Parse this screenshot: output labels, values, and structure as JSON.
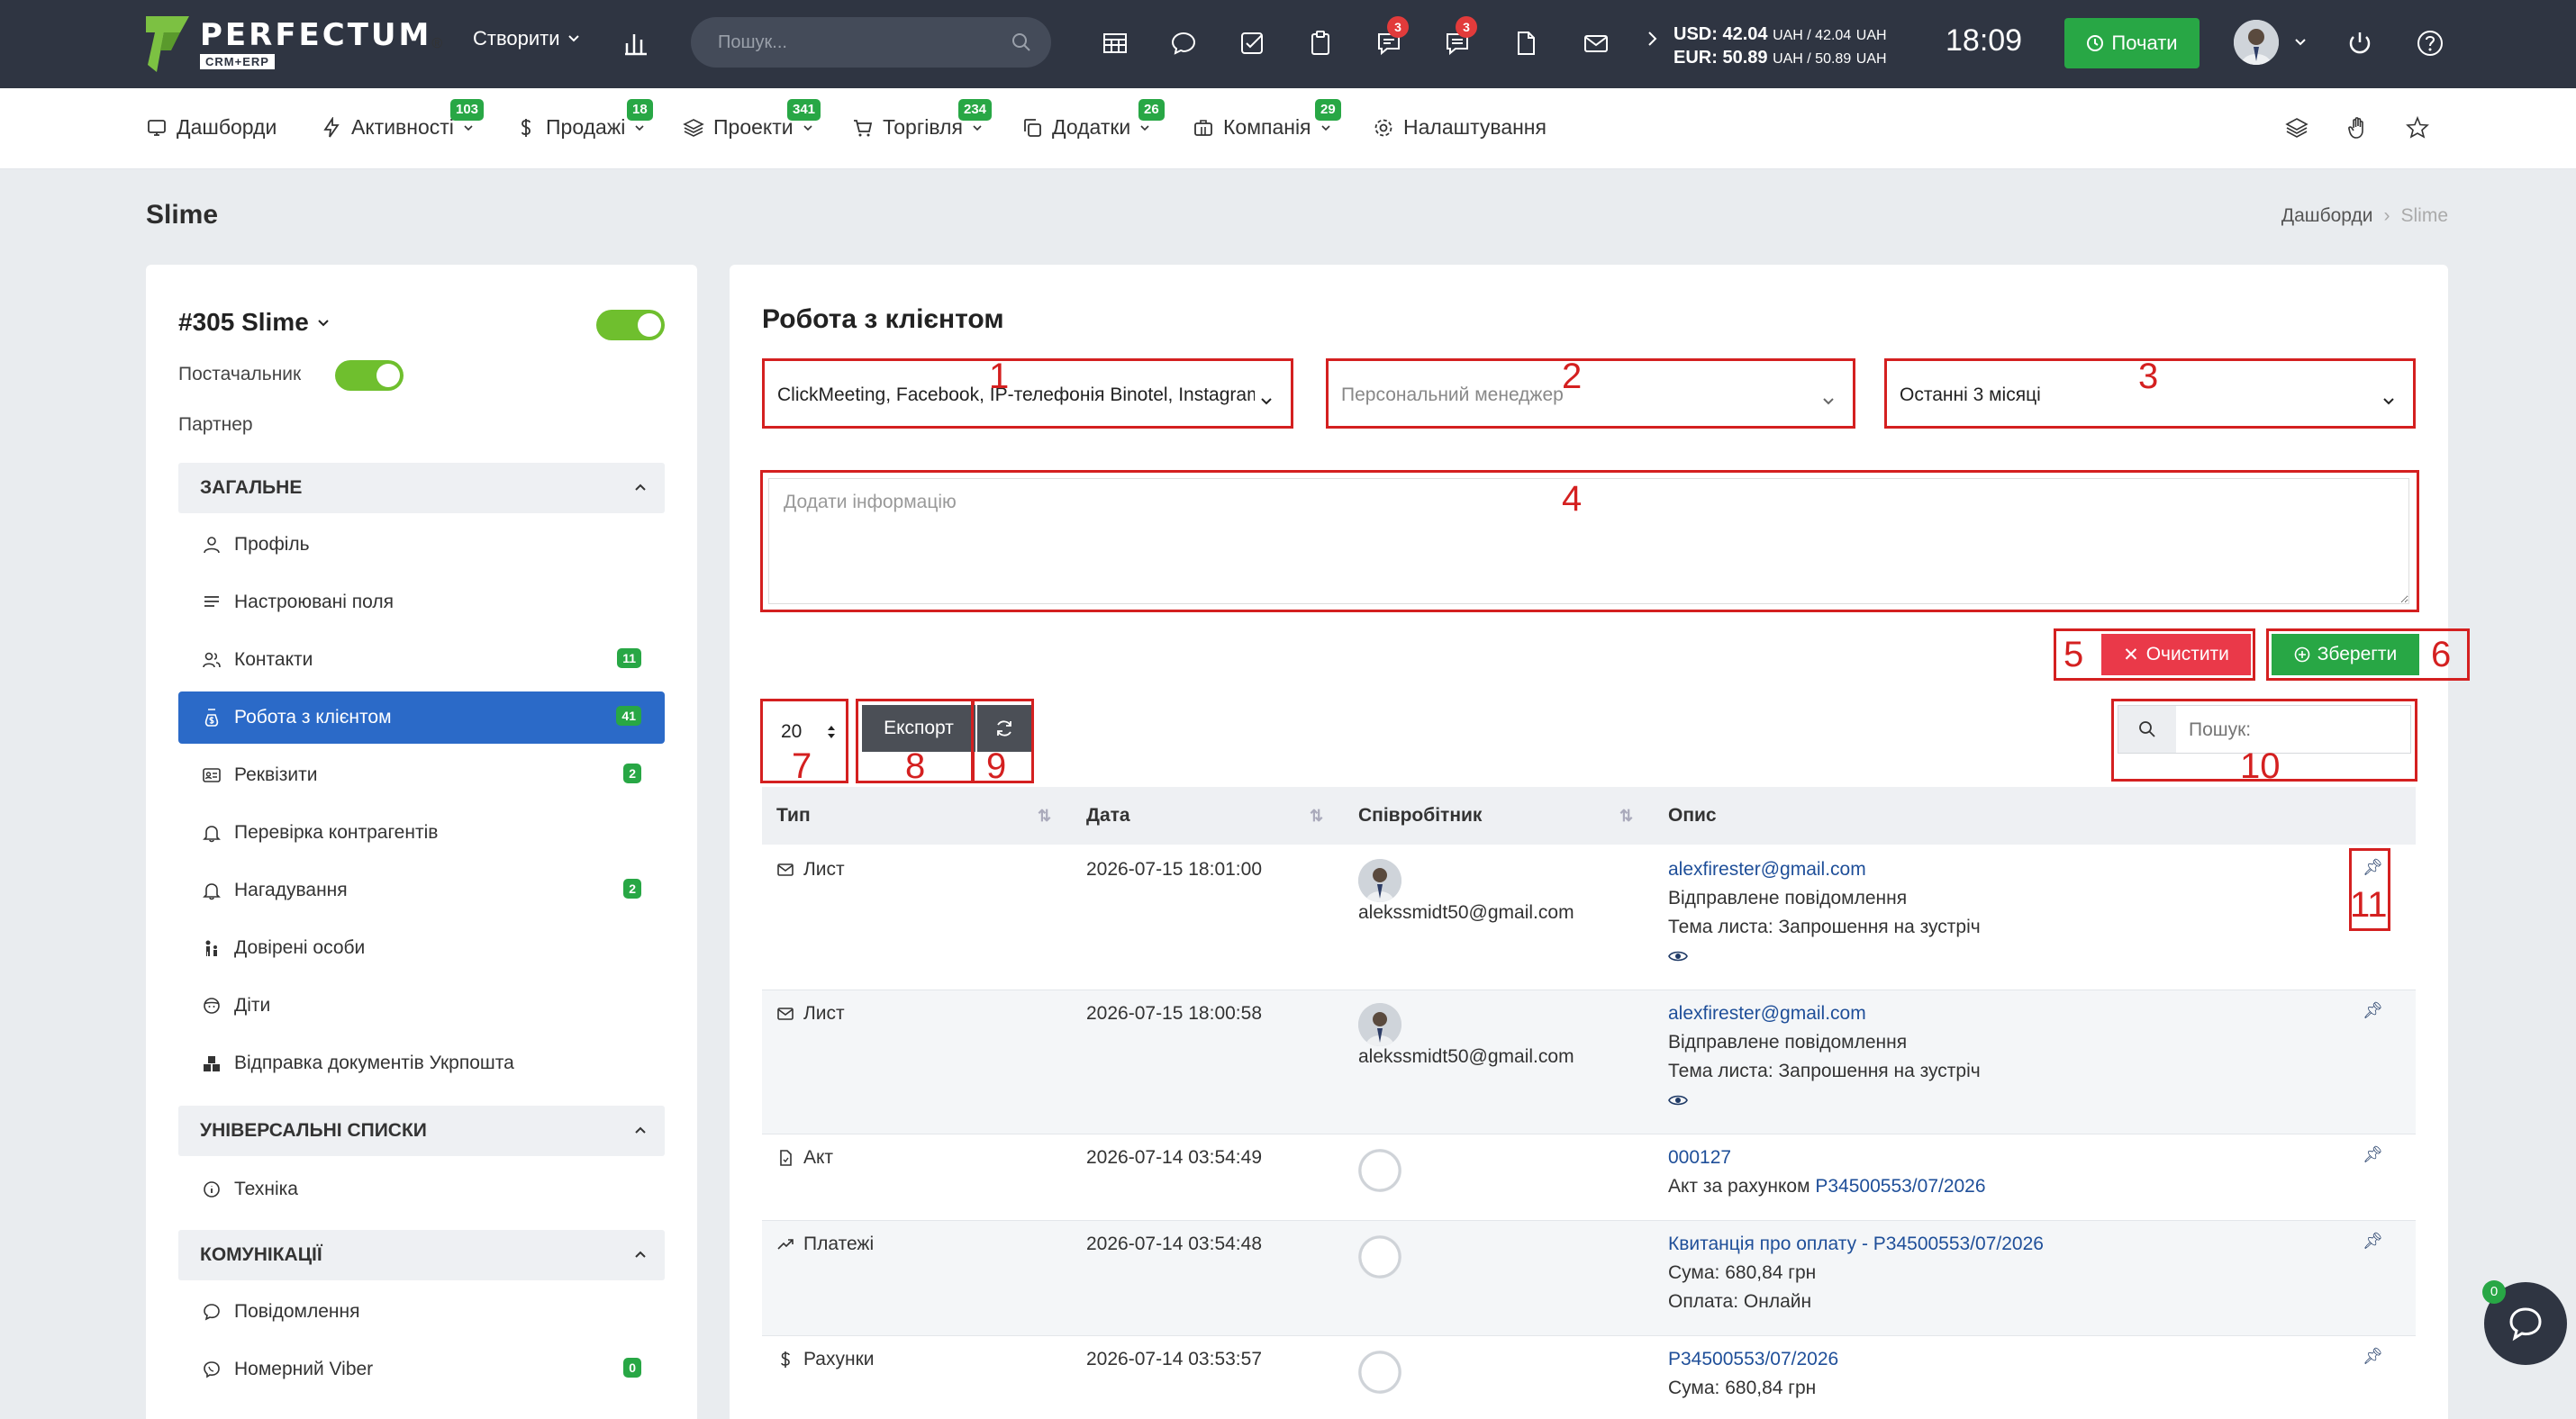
{
  "topbar": {
    "logo_text": "PERFECTUM",
    "logo_sub": "CRM+ERP",
    "logo_reg": "®",
    "create_label": "Створити",
    "search_placeholder": "Пошук...",
    "badge_messages": "3",
    "badge_chats": "3",
    "rate_usd": "USD: 42.04",
    "rate_usd_unit": "UAH / 42.04",
    "rate_usd_unit2": "UAH",
    "rate_eur": "EUR: 50.89",
    "rate_eur_unit": "UAH / 50.89",
    "rate_eur_unit2": "UAH",
    "clock": "18:09",
    "start_label": "Почати"
  },
  "menu": [
    {
      "label": "Дашборди",
      "icon": "monitor-icon"
    },
    {
      "label": "Активності",
      "icon": "bolt-icon",
      "badge": "103"
    },
    {
      "label": "Продажі",
      "icon": "dollar-icon",
      "badge": "18"
    },
    {
      "label": "Проекти",
      "icon": "layers-icon",
      "badge": "341"
    },
    {
      "label": "Торгівля",
      "icon": "cart-icon",
      "badge": "234"
    },
    {
      "label": "Додатки",
      "icon": "copy-icon",
      "badge": "26"
    },
    {
      "label": "Компанія",
      "icon": "briefcase-icon",
      "badge": "29"
    },
    {
      "label": "Налаштування",
      "icon": "gear-icon"
    }
  ],
  "page": {
    "title": "Slime",
    "breadcrumb_home": "Дашборди",
    "breadcrumb_current": "Slime"
  },
  "client": {
    "name": "#305 Slime",
    "supplier_label": "Постачальник",
    "partner_label": "Партнер"
  },
  "sections": {
    "general": "ЗАГАЛЬНЕ",
    "lists": "УНІВЕРСАЛЬНІ СПИСКИ",
    "comms": "КОМУНІКАЦІЇ"
  },
  "nav": [
    {
      "label": "Профіль",
      "icon": "user-icon"
    },
    {
      "label": "Настроювані поля",
      "icon": "lines-icon"
    },
    {
      "label": "Контакти",
      "icon": "users-icon",
      "count": "11"
    },
    {
      "label": "Робота з клієнтом",
      "icon": "dollar-circle-icon",
      "count": "41"
    },
    {
      "label": "Реквізити",
      "icon": "id-card-icon",
      "count": "2"
    },
    {
      "label": "Перевірка контрагентів",
      "icon": "bell-icon"
    },
    {
      "label": "Нагадування",
      "icon": "bell-icon",
      "count": "2"
    },
    {
      "label": "Довірені особи",
      "icon": "people-icon"
    },
    {
      "label": "Діти",
      "icon": "baby-icon"
    },
    {
      "label": "Відправка документів Укрпошта",
      "icon": "boxes-icon"
    },
    {
      "label": "Техніка",
      "icon": "info-icon"
    },
    {
      "label": "Повідомлення",
      "icon": "chat-icon"
    },
    {
      "label": "Номерний Viber",
      "icon": "viber-icon",
      "count": "0"
    }
  ],
  "work": {
    "title": "Робота з клієнтом",
    "sources_value": "ClickMeeting, Facebook, IP-телефонія Binotel, Instagram",
    "manager_placeholder": "Персональний менеджер",
    "period_value": "Останні 3 місяці",
    "note_placeholder": "Додати інформацію",
    "clear_label": "Очистити",
    "save_label": "Зберегти",
    "page_size": "20",
    "export_label": "Експорт",
    "search_placeholder": "Пошук:"
  },
  "markers": [
    "1",
    "2",
    "3",
    "4",
    "5",
    "6",
    "7",
    "8",
    "9",
    "10",
    "11"
  ],
  "table": {
    "headers": [
      "Тип",
      "Дата",
      "Співробітник",
      "Опис"
    ],
    "rows": [
      {
        "type": "Лист",
        "type_icon": "mail-icon",
        "date": "2026-07-15 18:01:00",
        "employee": "alekssmidt50@gmail.com",
        "desc1": "alexfirester@gmail.com",
        "desc2": "Відправлене повідомлення",
        "desc3": "Тема листа: Запрошення на зустріч"
      },
      {
        "type": "Лист",
        "type_icon": "mail-icon",
        "date": "2026-07-15 18:00:58",
        "employee": "alekssmidt50@gmail.com",
        "desc1": "alexfirester@gmail.com",
        "desc2": "Відправлене повідомлення",
        "desc3": "Тема листа: Запрошення на зустріч"
      },
      {
        "type": "Акт",
        "type_icon": "file-icon",
        "date": "2026-07-14 03:54:49",
        "employee": "",
        "desc1": "000127",
        "desc2_prefix": "Акт за рахунком ",
        "desc2_link": "P34500553/07/2026"
      },
      {
        "type": "Платежі",
        "type_icon": "trend-icon",
        "date": "2026-07-14 03:54:48",
        "employee": "",
        "desc1": "Квитанція про оплату - P34500553/07/2026",
        "desc2": "Сума: 680,84 грн",
        "desc3": "Оплата: Онлайн"
      },
      {
        "type": "Рахунки",
        "type_icon": "dollar-icon",
        "date": "2026-07-14 03:53:57",
        "employee": "",
        "desc1": "P34500553/07/2026",
        "desc2": "Сума: 680,84 грн"
      }
    ]
  },
  "chat": {
    "badge": "0"
  }
}
